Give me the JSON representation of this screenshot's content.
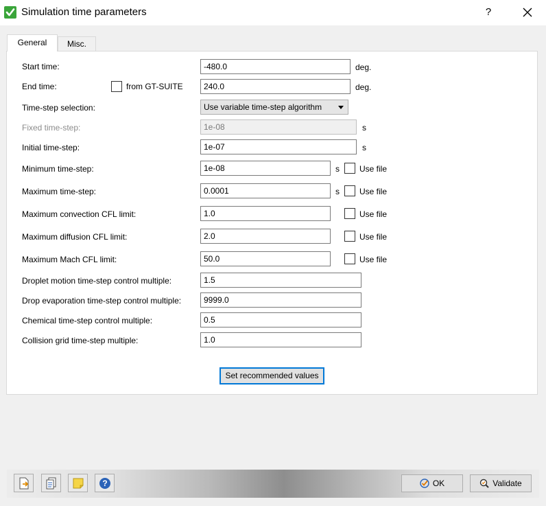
{
  "window": {
    "title": "Simulation time parameters",
    "help": "?",
    "app_icon": "check-icon",
    "close_icon": "close-icon"
  },
  "tabs": [
    {
      "label": "General",
      "active": true
    },
    {
      "label": "Misc.",
      "active": false
    }
  ],
  "form": {
    "start_time": {
      "label": "Start time:",
      "value": "-480.0",
      "unit": "deg."
    },
    "end_time": {
      "label": "End time:",
      "checkbox_label": "from GT-SUITE",
      "checked": false,
      "value": "240.0",
      "unit": "deg."
    },
    "time_step_selection": {
      "label": "Time-step selection:",
      "selected": "Use variable time-step algorithm"
    },
    "fixed_time_step": {
      "label": "Fixed time-step:",
      "value": "1e-08",
      "unit": "s",
      "disabled": true
    },
    "initial_time_step": {
      "label": "Initial time-step:",
      "value": "1e-07",
      "unit": "s"
    },
    "minimum_time_step": {
      "label": "Minimum time-step:",
      "value": "1e-08",
      "unit": "s",
      "use_file": "Use file"
    },
    "maximum_time_step": {
      "label": "Maximum time-step:",
      "value": "0.0001",
      "unit": "s",
      "use_file": "Use file"
    },
    "max_convection_cfl": {
      "label": "Maximum convection CFL limit:",
      "value": "1.0",
      "use_file": "Use file"
    },
    "max_diffusion_cfl": {
      "label": "Maximum diffusion CFL limit:",
      "value": "2.0",
      "use_file": "Use file"
    },
    "max_mach_cfl": {
      "label": "Maximum Mach CFL limit:",
      "value": "50.0",
      "use_file": "Use file"
    },
    "droplet_motion": {
      "label": "Droplet motion time-step control multiple:",
      "value": "1.5"
    },
    "drop_evaporation": {
      "label": "Drop evaporation time-step control multiple:",
      "value": "9999.0"
    },
    "chemical": {
      "label": "Chemical time-step control multiple:",
      "value": "0.5"
    },
    "collision_grid": {
      "label": "Collision grid time-step multiple:",
      "value": "1.0"
    }
  },
  "buttons": {
    "set_recommended": "Set recommended values",
    "ok": "OK",
    "validate": "Validate"
  },
  "toolbar_icons": [
    "export-icon",
    "copy-icon",
    "note-icon",
    "help-icon"
  ],
  "colors": {
    "accent": "#0078d7",
    "check_green": "#3aa53a",
    "help_blue": "#2b63b8"
  }
}
